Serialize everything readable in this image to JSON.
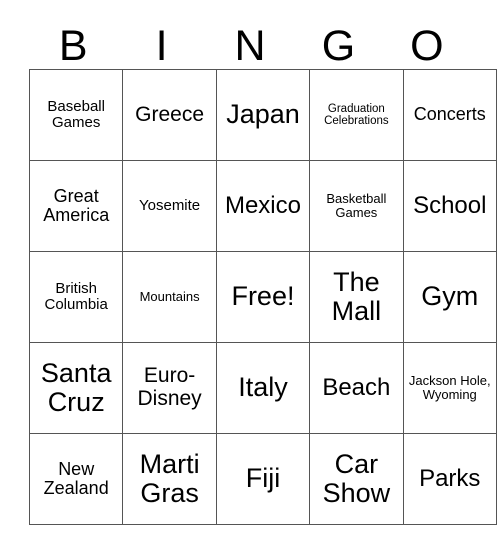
{
  "card": {
    "header": {
      "letters": [
        "B",
        "I",
        "N",
        "G",
        "O"
      ]
    },
    "grid": {
      "columns": 5,
      "rows": 5,
      "free_space_label": "Free!",
      "cells": [
        [
          {
            "text": "Baseball Games",
            "size": "s"
          },
          {
            "text": "Greece",
            "size": "l"
          },
          {
            "text": "Japan",
            "size": "xxl"
          },
          {
            "text": "Graduation Celebrations",
            "size": "xxs"
          },
          {
            "text": "Concerts",
            "size": "m"
          }
        ],
        [
          {
            "text": "Great America",
            "size": "m"
          },
          {
            "text": "Yosemite",
            "size": "s"
          },
          {
            "text": "Mexico",
            "size": "xl"
          },
          {
            "text": "Basketball Games",
            "size": "xs"
          },
          {
            "text": "School",
            "size": "xl"
          }
        ],
        [
          {
            "text": "British Columbia",
            "size": "s"
          },
          {
            "text": "Mountains",
            "size": "xs"
          },
          {
            "text": "Free!",
            "size": "xxl"
          },
          {
            "text": "The Mall",
            "size": "xxl"
          },
          {
            "text": "Gym",
            "size": "xxl"
          }
        ],
        [
          {
            "text": "Santa Cruz",
            "size": "xxl"
          },
          {
            "text": "Euro-Disney",
            "size": "l"
          },
          {
            "text": "Italy",
            "size": "xxl"
          },
          {
            "text": "Beach",
            "size": "xl"
          },
          {
            "text": "Jackson Hole, Wyoming",
            "size": "xs"
          }
        ],
        [
          {
            "text": "New Zealand",
            "size": "m"
          },
          {
            "text": "Marti Gras",
            "size": "xxl"
          },
          {
            "text": "Fiji",
            "size": "xxl"
          },
          {
            "text": "Car Show",
            "size": "xxl"
          },
          {
            "text": "Parks",
            "size": "xl"
          }
        ]
      ]
    },
    "colors": {
      "background": "#ffffff",
      "text": "#000000",
      "grid_line": "#555555"
    }
  }
}
